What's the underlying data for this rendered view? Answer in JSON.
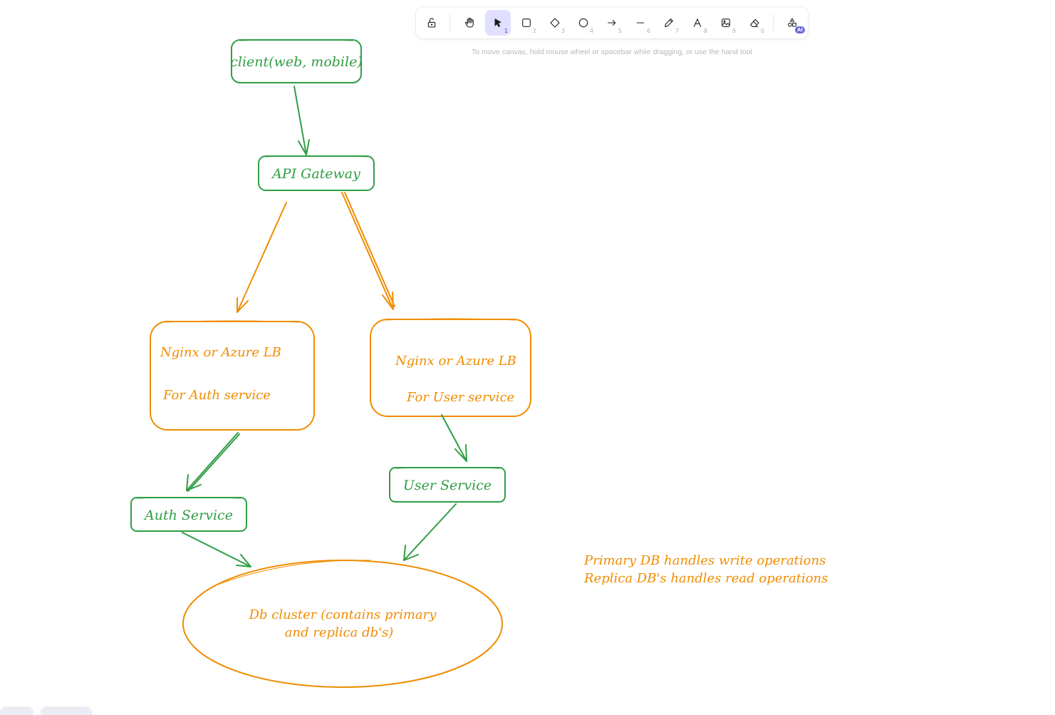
{
  "toolbar": {
    "tools": [
      {
        "name": "lock",
        "key": ""
      },
      {
        "name": "hand",
        "key": ""
      },
      {
        "name": "selection",
        "key": "1"
      },
      {
        "name": "rectangle",
        "key": "2"
      },
      {
        "name": "diamond",
        "key": "3"
      },
      {
        "name": "ellipse",
        "key": "4"
      },
      {
        "name": "arrow",
        "key": "5"
      },
      {
        "name": "line",
        "key": "6"
      },
      {
        "name": "draw",
        "key": "7"
      },
      {
        "name": "text",
        "key": "8"
      },
      {
        "name": "image",
        "key": "9"
      },
      {
        "name": "eraser",
        "key": "0"
      },
      {
        "name": "more-shapes",
        "key": ""
      }
    ],
    "active_tool": "selection",
    "ai_badge": "AI"
  },
  "hint": "To move canvas, hold mouse wheel or spacebar while dragging, or use the hand tool",
  "diagram": {
    "colors": {
      "green": "#2f9e44",
      "orange": "#f08c00"
    },
    "nodes": {
      "client": "client(web, mobile)",
      "gateway": "API Gateway",
      "lb_auth_line1": "Nginx or Azure LB",
      "lb_auth_line2": "For Auth service",
      "lb_user_line1": "Nginx or Azure LB",
      "lb_user_line2": "For User service",
      "auth_service": "Auth Service",
      "user_service": "User Service",
      "db_line1": "Db cluster (contains primary",
      "db_line2": "and replica db's)"
    },
    "note_line1": "Primary DB handles write operations",
    "note_line2": "Replica DB's handles read operations"
  }
}
